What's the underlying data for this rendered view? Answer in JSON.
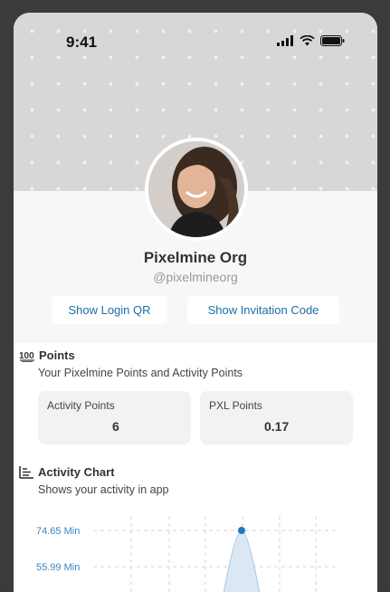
{
  "status_bar": {
    "time": "9:41"
  },
  "profile": {
    "name": "Pixelmine Org",
    "handle": "@pixelmineorg"
  },
  "actions": {
    "login_qr_label": "Show Login QR",
    "invitation_label": "Show Invitation Code"
  },
  "points": {
    "title": "Points",
    "subtitle": "Your Pixelmine Points and Activity Points",
    "cards": [
      {
        "label": "Activity Points",
        "value": "6"
      },
      {
        "label": "PXL Points",
        "value": "0.17"
      }
    ]
  },
  "activity": {
    "title": "Activity Chart",
    "subtitle": "Shows your activity in app"
  },
  "colors": {
    "accent": "#1a6fa8",
    "chart_point": "#1f78c1",
    "chart_fill": "#dbe8f4"
  },
  "chart_data": {
    "type": "area",
    "y_tick_labels": [
      "74.65 Min",
      "55.99 Min"
    ],
    "peak_value": 74.65,
    "grid": true
  }
}
